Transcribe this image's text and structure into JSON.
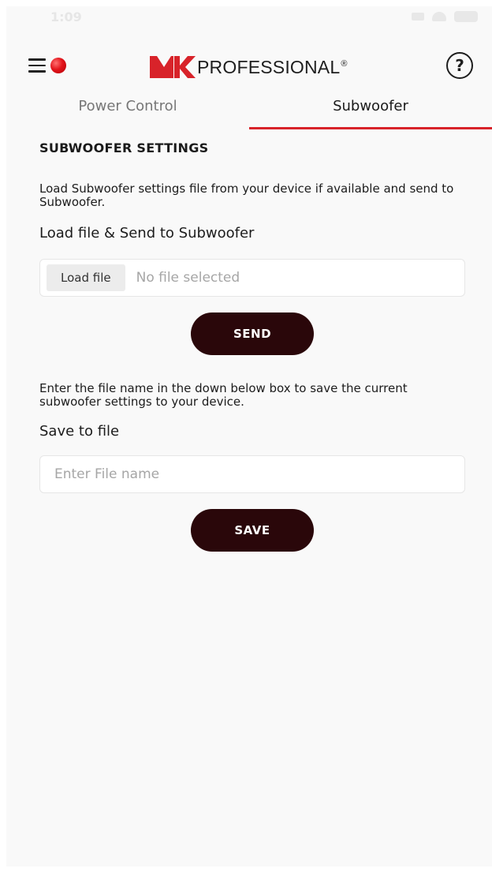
{
  "status": {
    "time": "1:09"
  },
  "header": {
    "brand_mark": "MK",
    "brand_text": "PROFESSIONAL",
    "brand_reg": "®",
    "help_glyph": "?",
    "brand_colors": {
      "red": "#d8232a",
      "dark": "#2a070a"
    }
  },
  "tabs": [
    {
      "label": "Power Control",
      "active": false
    },
    {
      "label": "Subwoofer",
      "active": true
    }
  ],
  "settings": {
    "title": "SUBWOOFER SETTINGS",
    "load_description": "Load Subwoofer settings file from your device if available and send to Subwoofer.",
    "load_heading": "Load file & Send to Subwoofer",
    "load_button": "Load file",
    "file_status": "No file selected",
    "send_label": "SEND",
    "save_description": "Enter the file name in the down below box to save the current subwoofer settings to your device.",
    "save_heading": "Save to file",
    "file_name_placeholder": "Enter File name",
    "save_label": "SAVE"
  },
  "icons": {
    "menu": "hamburger-menu-icon",
    "recording": "record-dot-icon",
    "help": "help-question-icon"
  }
}
